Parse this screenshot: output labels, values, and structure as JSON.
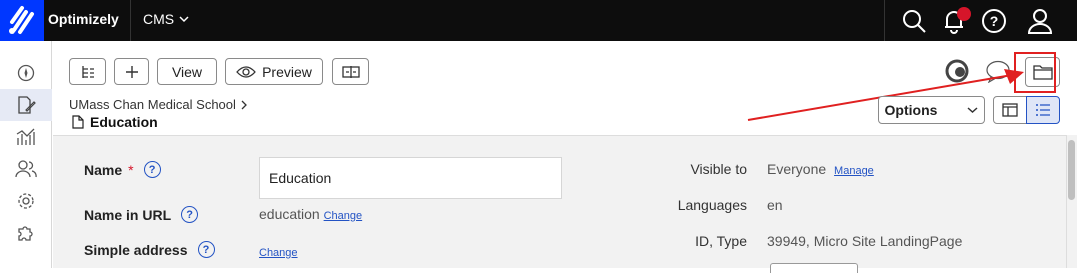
{
  "topbar": {
    "brand": "Optimizely",
    "product": "CMS",
    "icons": [
      "search-icon",
      "bell-icon",
      "help-icon",
      "user-icon"
    ],
    "accent": "#0037ff",
    "notification_color": "#d6152a"
  },
  "sidebar": {
    "items": [
      "compass-icon",
      "edit-icon",
      "chart-icon",
      "users-icon",
      "gear-icon",
      "puzzle-icon"
    ]
  },
  "toolbar": {
    "view_label": "View",
    "preview_label": "Preview",
    "options_label": "Options"
  },
  "breadcrumb": {
    "parent": "UMass Chan Medical School"
  },
  "page": {
    "title": "Education"
  },
  "form": {
    "name_label": "Name",
    "name_required": "*",
    "name_value": "Education",
    "url_label": "Name in URL",
    "url_value": "education",
    "url_change": "Change",
    "simple_label": "Simple address",
    "simple_change": "Change",
    "visible_label": "Visible to",
    "visible_value": "Everyone",
    "visible_manage": "Manage",
    "languages_label": "Languages",
    "languages_value": "en",
    "id_label": "ID, Type",
    "id_value": "39949, Micro Site LandingPage"
  },
  "help_glyph": "?"
}
